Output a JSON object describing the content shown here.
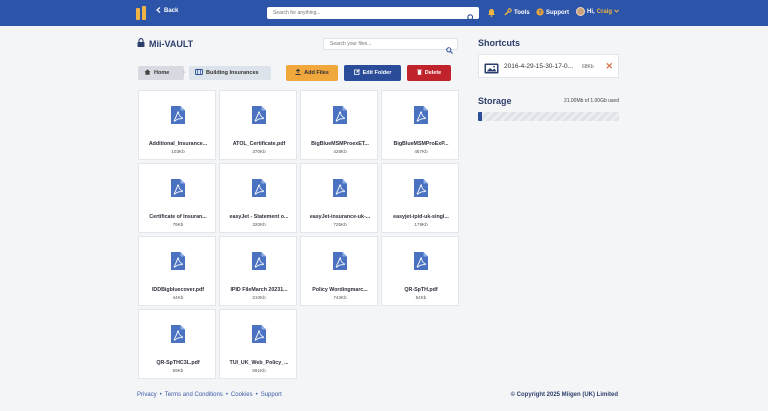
{
  "colors": {
    "topbar": "#2c54a8",
    "accent": "#f0a73b",
    "primary": "#2a4c99",
    "danger": "#c0232b"
  },
  "topbar": {
    "back_label": "Back",
    "search_placeholder": "Search for anything...",
    "tools_label": "Tools",
    "support_label": "Support",
    "greeting": "Hi,",
    "user_name": "Craig"
  },
  "vault": {
    "title": "Mii-VAULT",
    "search_placeholder": "Search your files..."
  },
  "breadcrumb": {
    "home": "Home",
    "current": "Building Insurances"
  },
  "actions": {
    "add_files": "Add Files",
    "edit_folder": "Edit Folder",
    "delete": "Delete"
  },
  "files": [
    {
      "name": "Additional_Insurance...",
      "size": "103Kb"
    },
    {
      "name": "ATOL_Certificate.pdf",
      "size": "370Kb"
    },
    {
      "name": "BigBlueMSMProexET...",
      "size": "428Kb"
    },
    {
      "name": "BigBlueMSMProExP...",
      "size": "457Kb"
    },
    {
      "name": "Certificate of Insuran...",
      "size": "79Kb"
    },
    {
      "name": "easyJet - Statement o...",
      "size": "320Kb"
    },
    {
      "name": "easyJet-insurance-uk-...",
      "size": "725Kb"
    },
    {
      "name": "easyjet-ipid-uk-singl...",
      "size": "179Kb"
    },
    {
      "name": "IDDBigbluecover.pdf",
      "size": "44Kb"
    },
    {
      "name": "IPID FileMarch 20231...",
      "size": "210Kb"
    },
    {
      "name": "Policy Wordingmarc...",
      "size": "743Kb"
    },
    {
      "name": "QR-SpTH.pdf",
      "size": "54Kb"
    },
    {
      "name": "QR-SpTHC3L.pdf",
      "size": "59Kb"
    },
    {
      "name": "TUI_UK_Web_Policy_...",
      "size": "591Kb"
    }
  ],
  "shortcuts": {
    "title": "Shortcuts",
    "item": {
      "name": "2016-4-29-15-30-17-0...",
      "size": "68Kb"
    }
  },
  "storage": {
    "title": "Storage",
    "used_text": "21.00Mb of 1.00Gb used",
    "used_fraction": 0.021
  },
  "footer": {
    "privacy": "Privacy",
    "terms": "Terms and Conditions",
    "cookies": "Cookies",
    "support": "Support",
    "copyright": "© Copyright 2025 Miigen (UK) Limited"
  }
}
